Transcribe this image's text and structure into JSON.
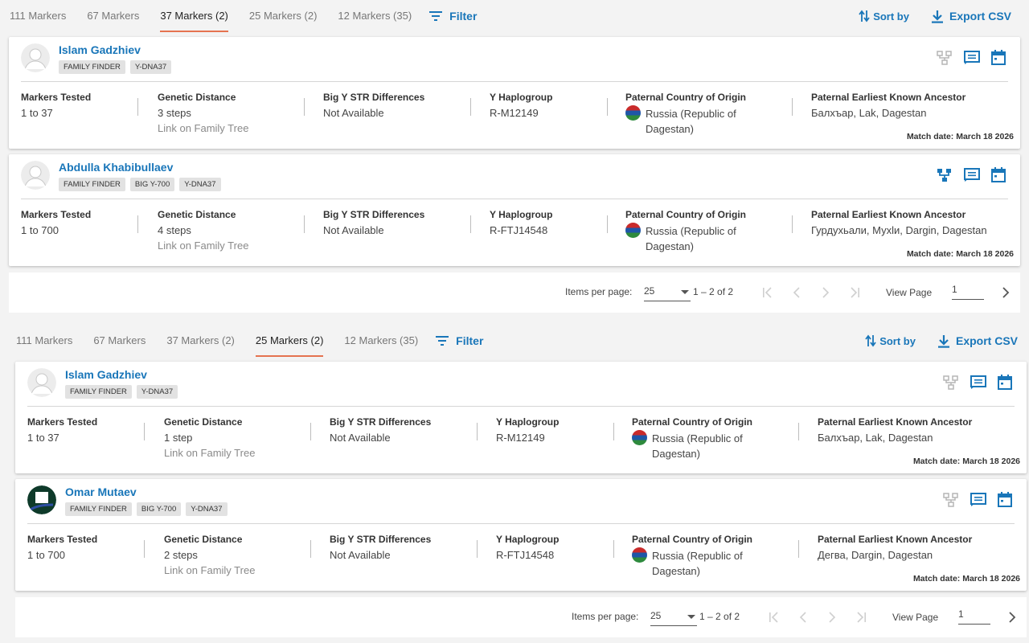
{
  "sections": [
    {
      "tabs": [
        "111 Markers",
        "67 Markers",
        "37 Markers (2)",
        "25 Markers (2)",
        "12 Markers (35)"
      ],
      "active_tab": "37 Markers (2)",
      "filter_label": "Filter",
      "sort_label": "Sort by",
      "export_label": "Export CSV",
      "matches": [
        {
          "name": "Islam Gadzhiev",
          "avatar": "default-avatar-icon",
          "badges": [
            "Family Finder",
            "Y-DNA37"
          ],
          "tree_icon_active": false,
          "markers_tested_label": "Markers Tested",
          "markers_tested": "1 to 37",
          "genetic_distance_label": "Genetic Distance",
          "genetic_distance": "3 steps",
          "family_tree_link": "Link on Family Tree",
          "bigy_label": "Big Y STR Differences",
          "bigy": "Not Available",
          "haplogroup_label": "Y Haplogroup",
          "haplogroup": "R-M12149",
          "country_label": "Paternal Country of Origin",
          "country": "Russia (Republic of Dagestan)",
          "ancestor_label": "Paternal Earliest Known Ancestor",
          "ancestor": "Балхъар, Lak, Dagestan",
          "match_date": "Match date: March 18 2026"
        },
        {
          "name": "Abdulla Khabibullaev",
          "avatar": "default-avatar-icon",
          "badges": [
            "Family Finder",
            "Big Y-700",
            "Y-DNA37"
          ],
          "tree_icon_active": true,
          "markers_tested_label": "Markers Tested",
          "markers_tested": "1 to 700",
          "genetic_distance_label": "Genetic Distance",
          "genetic_distance": "4 steps",
          "family_tree_link": "Link on Family Tree",
          "bigy_label": "Big Y STR Differences",
          "bigy": "Not Available",
          "haplogroup_label": "Y Haplogroup",
          "haplogroup": "R-FTJ14548",
          "country_label": "Paternal Country of Origin",
          "country": "Russia (Republic of Dagestan)",
          "ancestor_label": "Paternal Earliest Known Ancestor",
          "ancestor": "Гурдухьали, Мухlи, Dargin, Dagestan",
          "match_date": "Match date: March 18 2026"
        }
      ],
      "pager": {
        "items_label": "Items per page:",
        "per_page": "25",
        "range": "1 – 2 of 2",
        "view_label": "View Page",
        "page": "1"
      }
    },
    {
      "tabs": [
        "111 Markers",
        "67 Markers",
        "37 Markers (2)",
        "25 Markers (2)",
        "12 Markers (35)"
      ],
      "active_tab": "25 Markers (2)",
      "filter_label": "Filter",
      "sort_label": "Sort by",
      "export_label": "Export CSV",
      "matches": [
        {
          "name": "Islam Gadzhiev",
          "avatar": "default-avatar-icon",
          "badges": [
            "Family Finder",
            "Y-DNA37"
          ],
          "tree_icon_active": false,
          "markers_tested_label": "Markers Tested",
          "markers_tested": "1 to 37",
          "genetic_distance_label": "Genetic Distance",
          "genetic_distance": "1 step",
          "family_tree_link": "Link on Family Tree",
          "bigy_label": "Big Y STR Differences",
          "bigy": "Not Available",
          "haplogroup_label": "Y Haplogroup",
          "haplogroup": "R-M12149",
          "country_label": "Paternal Country of Origin",
          "country": "Russia (Republic of Dagestan)",
          "ancestor_label": "Paternal Earliest Known Ancestor",
          "ancestor": "Балхъар, Lak, Dagestan",
          "match_date": "Match date: March 18 2026"
        },
        {
          "name": "Omar Mutaev",
          "avatar": "custom-logo-avatar-icon",
          "badges": [
            "Family Finder",
            "Big Y-700",
            "Y-DNA37"
          ],
          "tree_icon_active": false,
          "markers_tested_label": "Markers Tested",
          "markers_tested": "1 to 700",
          "genetic_distance_label": "Genetic Distance",
          "genetic_distance": "2 steps",
          "family_tree_link": "Link on Family Tree",
          "bigy_label": "Big Y STR Differences",
          "bigy": "Not Available",
          "haplogroup_label": "Y Haplogroup",
          "haplogroup": "R-FTJ14548",
          "country_label": "Paternal Country of Origin",
          "country": "Russia (Republic of Dagestan)",
          "ancestor_label": "Paternal Earliest Known Ancestor",
          "ancestor": "Дегва, Dargin, Dagestan",
          "match_date": "Match date: March 18 2026"
        }
      ],
      "pager": {
        "items_label": "Items per page:",
        "per_page": "25",
        "range": "1 – 2 of 2",
        "view_label": "View Page",
        "page": "1"
      }
    }
  ],
  "colors": {
    "link": "#1976b9",
    "active_tab_underline": "#e57350",
    "badge_bg": "#e2e2e2",
    "inactive_icon": "#b5b5b5"
  }
}
